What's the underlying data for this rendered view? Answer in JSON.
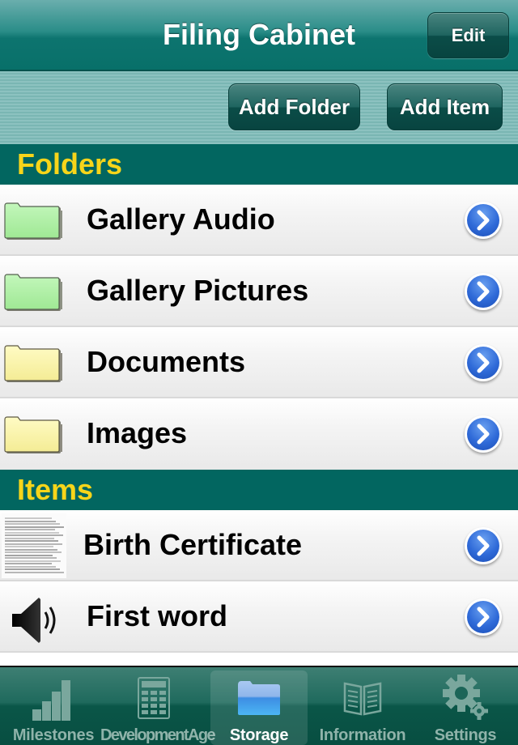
{
  "header": {
    "title": "Filing Cabinet",
    "edit_label": "Edit"
  },
  "toolbar": {
    "add_folder_label": "Add Folder",
    "add_item_label": "Add Item"
  },
  "folders": {
    "header": "Folders",
    "items": [
      {
        "label": "Gallery Audio",
        "icon": "folder-icon",
        "color": "#aef2a4"
      },
      {
        "label": "Gallery Pictures",
        "icon": "folder-icon",
        "color": "#aef2a4"
      },
      {
        "label": "Documents",
        "icon": "folder-icon",
        "color": "#fbf6a8"
      },
      {
        "label": "Images",
        "icon": "folder-icon",
        "color": "#fbf6a8"
      }
    ]
  },
  "items": {
    "header": "Items",
    "items": [
      {
        "label": "Birth Certificate",
        "icon": "document-thumbnail"
      },
      {
        "label": "First word",
        "icon": "speaker-icon"
      }
    ]
  },
  "tabbar": {
    "tabs": [
      {
        "label": "Milestones",
        "icon": "bar-steps-icon",
        "active": false
      },
      {
        "label": "DevelopmentAge",
        "icon": "calculator-icon",
        "active": false
      },
      {
        "label": "Storage",
        "icon": "blue-folder-icon",
        "active": true
      },
      {
        "label": "Information",
        "icon": "open-book-icon",
        "active": false
      },
      {
        "label": "Settings",
        "icon": "gears-icon",
        "active": false
      }
    ]
  },
  "colors": {
    "accent_teal": "#026660",
    "section_text": "#f7d51a",
    "disclosure_blue": "#2f6ad8"
  }
}
